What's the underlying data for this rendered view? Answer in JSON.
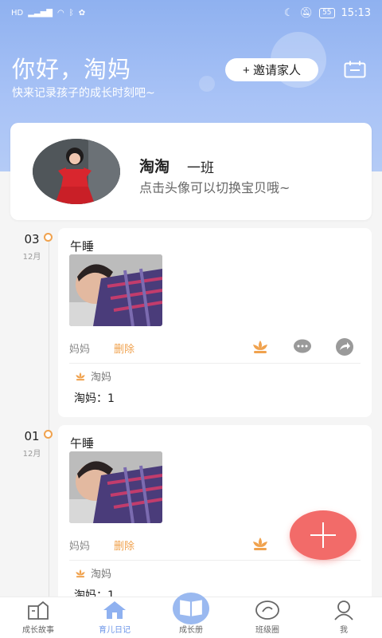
{
  "statusbar": {
    "left_icons": [
      "hd-icon",
      "signal-icon",
      "wifi-icon",
      "bluetooth-icon",
      "huawei-icon"
    ],
    "battery": "55",
    "time": "15:13"
  },
  "header": {
    "greeting": "你好，淘妈",
    "subtitle": "快来记录孩子的成长时刻吧~",
    "invite_label": "+ 邀请家人"
  },
  "profile": {
    "name": "淘淘",
    "class_name": "一班",
    "hint": "点击头像可以切换宝贝哦~"
  },
  "entries": [
    {
      "day": "03",
      "month": "12月",
      "title": "午睡",
      "author": "妈妈",
      "delete_label": "删除",
      "liker": "淘妈",
      "comment": "淘妈：1"
    },
    {
      "day": "01",
      "month": "12月",
      "title": "午睡",
      "author": "妈妈",
      "delete_label": "删除",
      "liker": "淘妈",
      "comment": "淘妈：1"
    }
  ],
  "tabs": [
    {
      "label": "成长故事",
      "icon": "story-icon"
    },
    {
      "label": "育儿日记",
      "icon": "home-icon"
    },
    {
      "label": "成长册",
      "icon": "book-icon"
    },
    {
      "label": "班级圈",
      "icon": "circle-icon"
    },
    {
      "label": "我",
      "icon": "user-icon"
    }
  ],
  "colors": {
    "header_blue": "#8fb1f0",
    "accent_orange": "#f0a24e",
    "fab_red": "#f26b69",
    "active_tab": "#6c95e8"
  }
}
